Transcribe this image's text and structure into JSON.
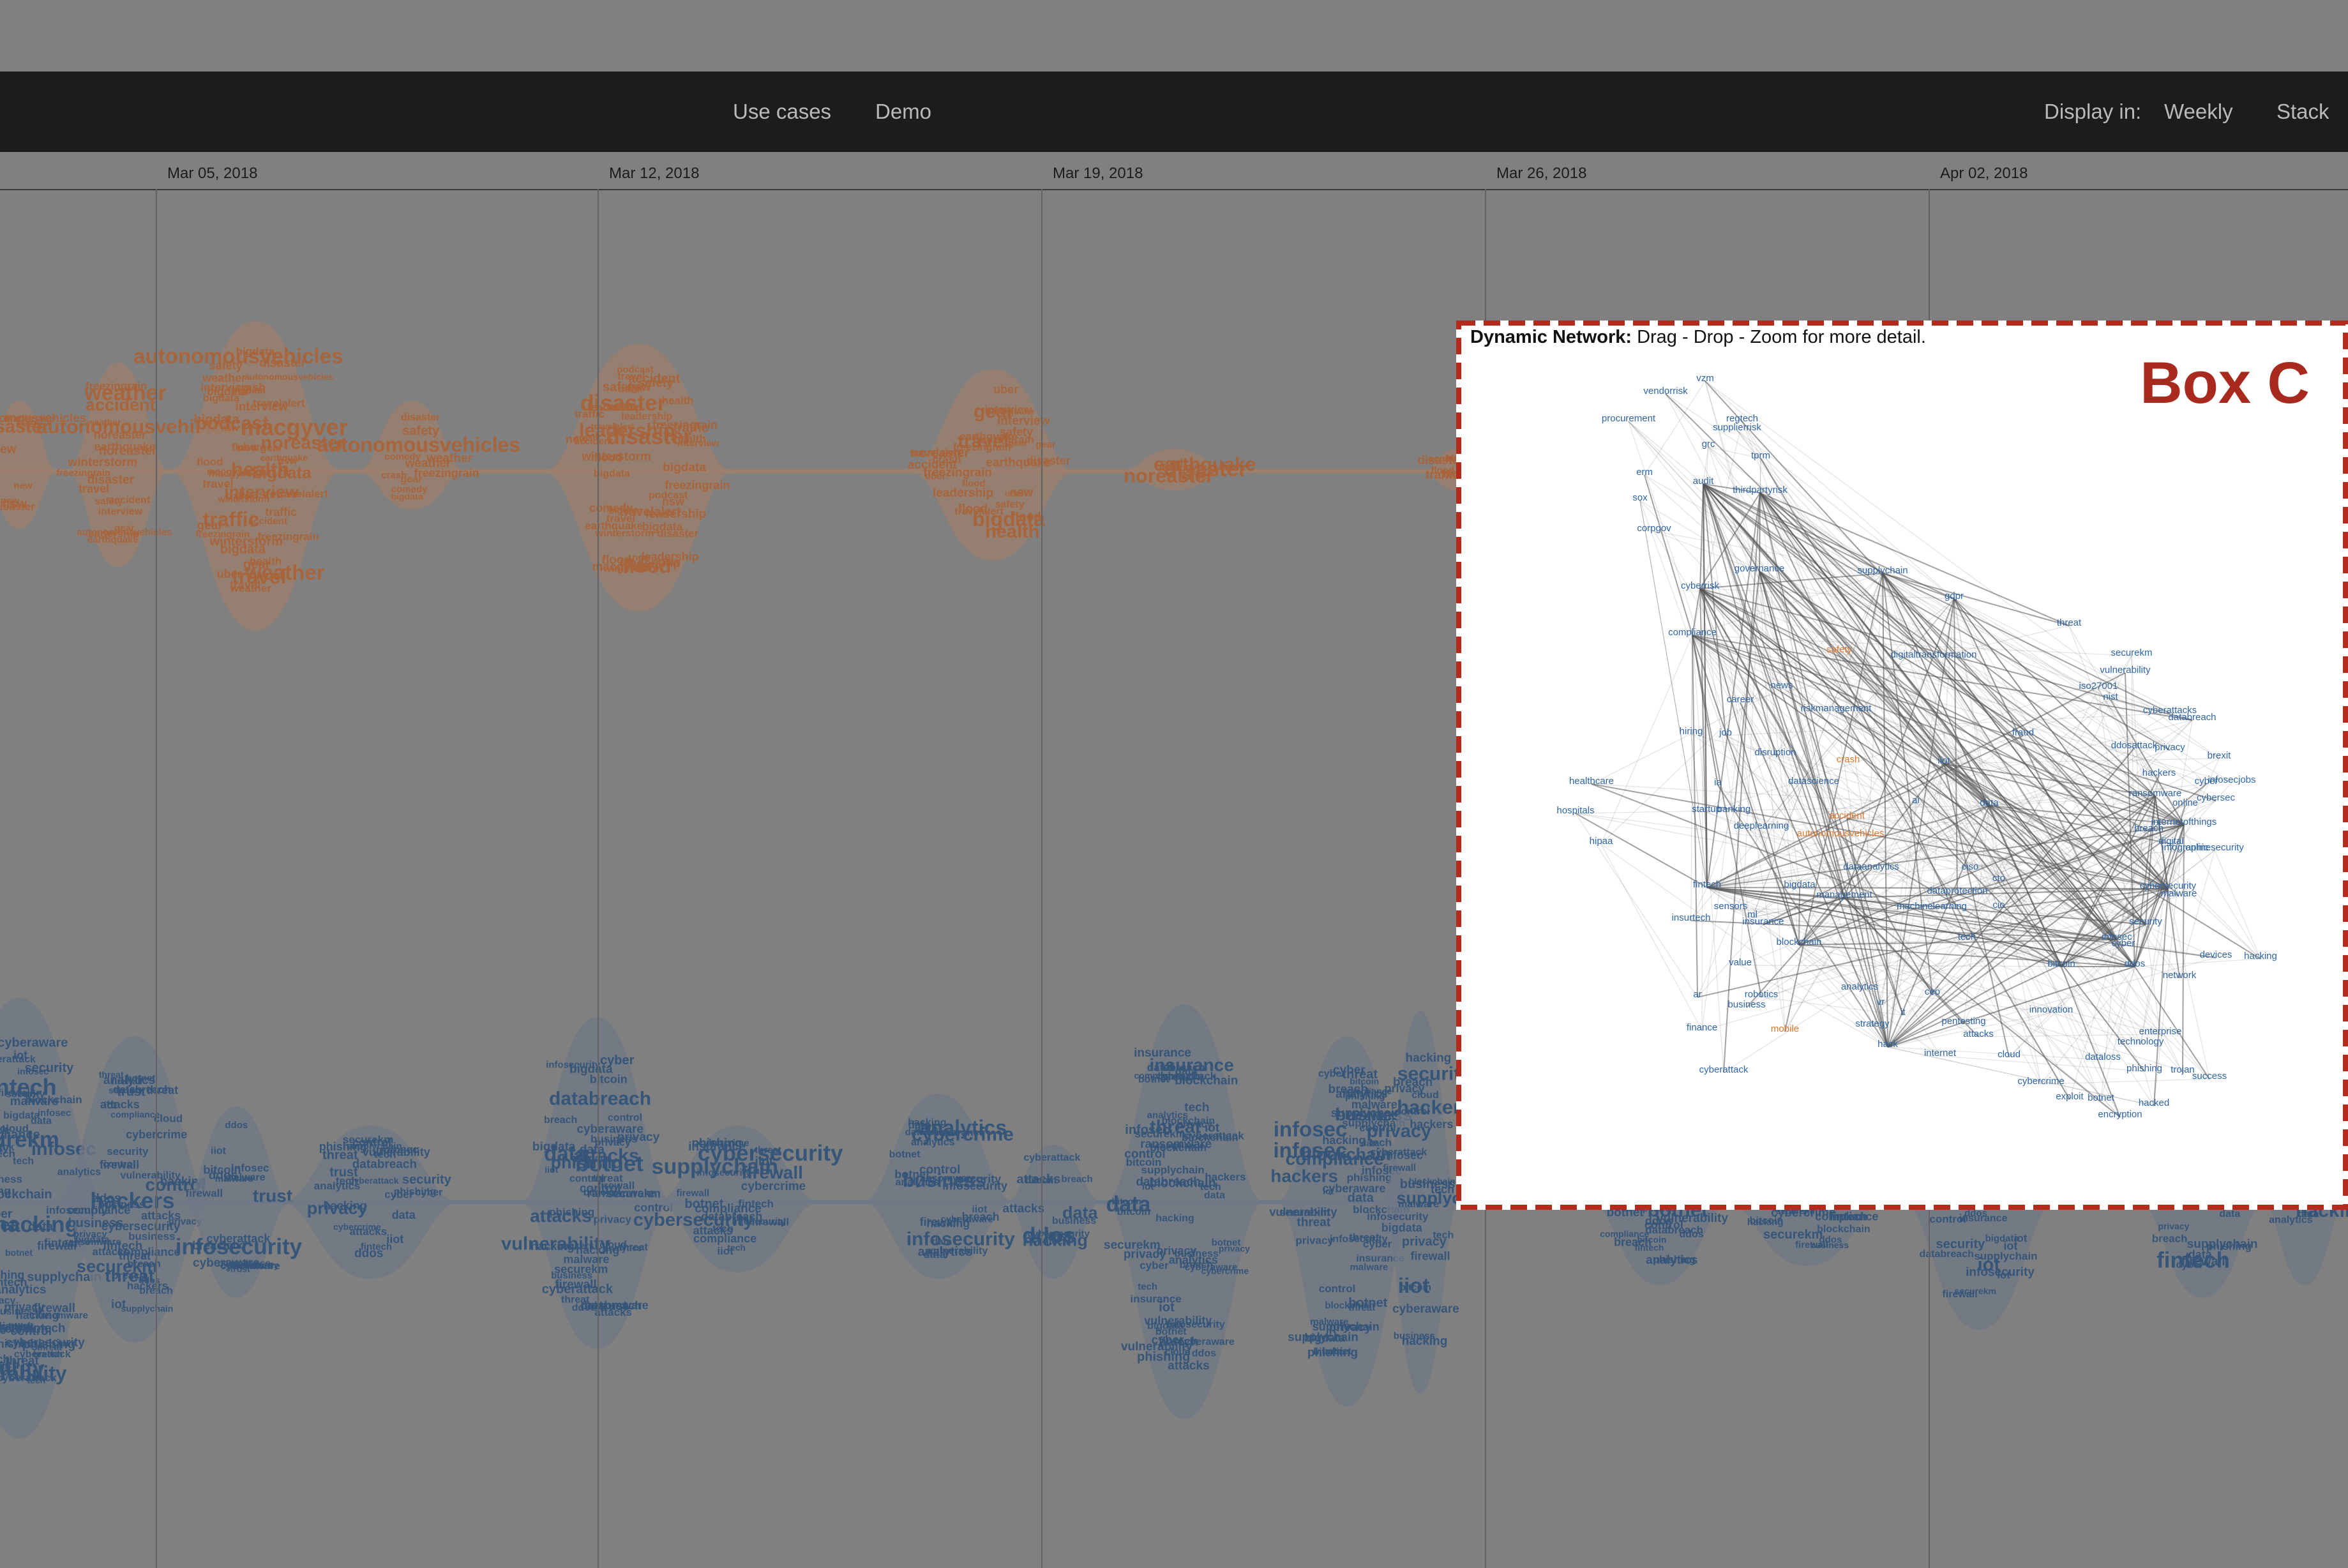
{
  "nav": {
    "use_cases": "Use cases",
    "demo": "Demo",
    "display_in": "Display in:",
    "weekly": "Weekly",
    "stack": "Stack"
  },
  "timeline": {
    "dates": [
      "Mar 05, 2018",
      "Mar 12, 2018",
      "Mar 19, 2018",
      "Mar 26, 2018",
      "Apr 02, 2018"
    ]
  },
  "colors": {
    "page_bg": "#808080",
    "navbar_bg": "#1c1c1c",
    "nav_text": "#b9b9b9",
    "stream_orange_fill": "#9c7f6c",
    "stream_orange_text": "#a8643a",
    "stream_blue_fill": "#6f7886",
    "stream_blue_text": "#355579",
    "box_border": "#b42b1c",
    "box_label": "#a82a1e",
    "node_blue": "#2f66a8",
    "node_orange": "#e0772c",
    "edge": "#555555"
  },
  "orange_stream_words": [
    "safety",
    "travel",
    "leadership",
    "earthquake",
    "disaster",
    "flood",
    "macgyver",
    "interview",
    "comedy",
    "crash",
    "accident",
    "traffic",
    "noreaster",
    "podcast",
    "health",
    "winterstorm",
    "freezingrain",
    "travelalert",
    "weather",
    "autonomousvehicles",
    "uber",
    "bigdata",
    "gear",
    "nsw",
    "new"
  ],
  "blue_stream_words": [
    "cybersecurity",
    "security",
    "infosec",
    "iiot",
    "ddos",
    "breach",
    "privacy",
    "malware",
    "cyber",
    "bigdata",
    "databreach",
    "hackers",
    "cyberattack",
    "attacks",
    "insurance",
    "fintech",
    "blockchain",
    "business",
    "vulnerability",
    "ransomware",
    "phishing",
    "cloud",
    "data",
    "botnet",
    "trust",
    "threat",
    "tech",
    "analytics",
    "cybercrime",
    "cyberaware",
    "infosecurity",
    "securekm",
    "control",
    "supplychain",
    "firewall",
    "bitcoin",
    "iot",
    "hacking",
    "privacy",
    "compliance"
  ],
  "dynamic_network": {
    "title_bold": "Dynamic Network:",
    "title_rest": " Drag - Drop - Zoom for more detail.",
    "box_label": "Box C",
    "nodes": [
      {
        "label": "vzm",
        "color": "blue"
      },
      {
        "label": "vendorrisk",
        "color": "blue"
      },
      {
        "label": "regtech",
        "color": "blue"
      },
      {
        "label": "procurement",
        "color": "blue"
      },
      {
        "label": "supplierrisk",
        "color": "blue"
      },
      {
        "label": "grc",
        "color": "blue"
      },
      {
        "label": "tprm",
        "color": "blue"
      },
      {
        "label": "erm",
        "color": "blue"
      },
      {
        "label": "audit",
        "color": "blue"
      },
      {
        "label": "thirdpartyrisk",
        "color": "blue"
      },
      {
        "label": "sox",
        "color": "blue"
      },
      {
        "label": "corpgov",
        "color": "blue"
      },
      {
        "label": "governance",
        "color": "blue"
      },
      {
        "label": "supplychain",
        "color": "blue"
      },
      {
        "label": "cyberrisk",
        "color": "blue"
      },
      {
        "label": "gdpr",
        "color": "blue"
      },
      {
        "label": "threat",
        "color": "blue"
      },
      {
        "label": "compliance",
        "color": "blue"
      },
      {
        "label": "safety",
        "color": "orange"
      },
      {
        "label": "digitaltransformation",
        "color": "blue"
      },
      {
        "label": "securekm",
        "color": "blue"
      },
      {
        "label": "vulnerability",
        "color": "blue"
      },
      {
        "label": "iso27001",
        "color": "blue"
      },
      {
        "label": "news",
        "color": "blue"
      },
      {
        "label": "career",
        "color": "blue"
      },
      {
        "label": "nist",
        "color": "blue"
      },
      {
        "label": "riskmanagement",
        "color": "blue"
      },
      {
        "label": "cyberattacks",
        "color": "blue"
      },
      {
        "label": "databreach",
        "color": "blue"
      },
      {
        "label": "hiring",
        "color": "blue"
      },
      {
        "label": "job",
        "color": "blue"
      },
      {
        "label": "fraud",
        "color": "blue"
      },
      {
        "label": "ddosattack",
        "color": "blue"
      },
      {
        "label": "privacy",
        "color": "blue"
      },
      {
        "label": "disruption",
        "color": "blue"
      },
      {
        "label": "crash",
        "color": "orange"
      },
      {
        "label": "iiot",
        "color": "blue"
      },
      {
        "label": "brexit",
        "color": "blue"
      },
      {
        "label": "hackers",
        "color": "blue"
      },
      {
        "label": "healthcare",
        "color": "blue"
      },
      {
        "label": "ia",
        "color": "blue"
      },
      {
        "label": "datascience",
        "color": "blue"
      },
      {
        "label": "cyber",
        "color": "blue"
      },
      {
        "label": "infosecjobs",
        "color": "blue"
      },
      {
        "label": "ransomware",
        "color": "blue"
      },
      {
        "label": "startup",
        "color": "blue"
      },
      {
        "label": "banking",
        "color": "blue"
      },
      {
        "label": "accident",
        "color": "orange"
      },
      {
        "label": "ai",
        "color": "blue"
      },
      {
        "label": "data",
        "color": "blue"
      },
      {
        "label": "online",
        "color": "blue"
      },
      {
        "label": "cybersec",
        "color": "blue"
      },
      {
        "label": "hospitals",
        "color": "blue"
      },
      {
        "label": "deeplearning",
        "color": "blue"
      },
      {
        "label": "internetofthings",
        "color": "blue"
      },
      {
        "label": "breach",
        "color": "blue"
      },
      {
        "label": "autonomousvehicles",
        "color": "orange"
      },
      {
        "label": "digital",
        "color": "blue"
      },
      {
        "label": "infographic",
        "color": "blue"
      },
      {
        "label": "onlinesecurity",
        "color": "blue"
      },
      {
        "label": "hipaa",
        "color": "blue"
      },
      {
        "label": "dataanalytics",
        "color": "blue"
      },
      {
        "label": "ciso",
        "color": "blue"
      },
      {
        "label": "fintech",
        "color": "blue"
      },
      {
        "label": "bigdata",
        "color": "blue"
      },
      {
        "label": "cto",
        "color": "blue"
      },
      {
        "label": "dataprotection",
        "color": "blue"
      },
      {
        "label": "cybersecurity",
        "color": "blue"
      },
      {
        "label": "malware",
        "color": "blue"
      },
      {
        "label": "management",
        "color": "blue"
      },
      {
        "label": "cio",
        "color": "blue"
      },
      {
        "label": "sensors",
        "color": "blue"
      },
      {
        "label": "insurtech",
        "color": "blue"
      },
      {
        "label": "ml",
        "color": "blue"
      },
      {
        "label": "machinelearning",
        "color": "blue"
      },
      {
        "label": "insurance",
        "color": "blue"
      },
      {
        "label": "security",
        "color": "blue"
      },
      {
        "label": "infosec",
        "color": "blue"
      },
      {
        "label": "tech",
        "color": "blue"
      },
      {
        "label": "blockchain",
        "color": "blue"
      },
      {
        "label": "cyber",
        "color": "blue"
      },
      {
        "label": "devices",
        "color": "blue"
      },
      {
        "label": "hacking",
        "color": "blue"
      },
      {
        "label": "value",
        "color": "blue"
      },
      {
        "label": "bitcoin",
        "color": "blue"
      },
      {
        "label": "ddos",
        "color": "blue"
      },
      {
        "label": "network",
        "color": "blue"
      },
      {
        "label": "ar",
        "color": "blue"
      },
      {
        "label": "robotics",
        "color": "blue"
      },
      {
        "label": "analytics",
        "color": "blue"
      },
      {
        "label": "ceo",
        "color": "blue"
      },
      {
        "label": "vr",
        "color": "blue"
      },
      {
        "label": "business",
        "color": "blue"
      },
      {
        "label": "it",
        "color": "blue"
      },
      {
        "label": "innovation",
        "color": "blue"
      },
      {
        "label": "finance",
        "color": "blue"
      },
      {
        "label": "mobile",
        "color": "orange"
      },
      {
        "label": "strategy",
        "color": "blue"
      },
      {
        "label": "pentesting",
        "color": "blue"
      },
      {
        "label": "enterprise",
        "color": "blue"
      },
      {
        "label": "attacks",
        "color": "blue"
      },
      {
        "label": "technology",
        "color": "blue"
      },
      {
        "label": "hack",
        "color": "blue"
      },
      {
        "label": "internet",
        "color": "blue"
      },
      {
        "label": "cloud",
        "color": "blue"
      },
      {
        "label": "dataloss",
        "color": "blue"
      },
      {
        "label": "phishing",
        "color": "blue"
      },
      {
        "label": "trojan",
        "color": "blue"
      },
      {
        "label": "success",
        "color": "blue"
      },
      {
        "label": "cyberattack",
        "color": "blue"
      },
      {
        "label": "cybercrime",
        "color": "blue"
      },
      {
        "label": "exploit",
        "color": "blue"
      },
      {
        "label": "botnet",
        "color": "blue"
      },
      {
        "label": "hacked",
        "color": "blue"
      },
      {
        "label": "encryption",
        "color": "blue"
      }
    ]
  }
}
